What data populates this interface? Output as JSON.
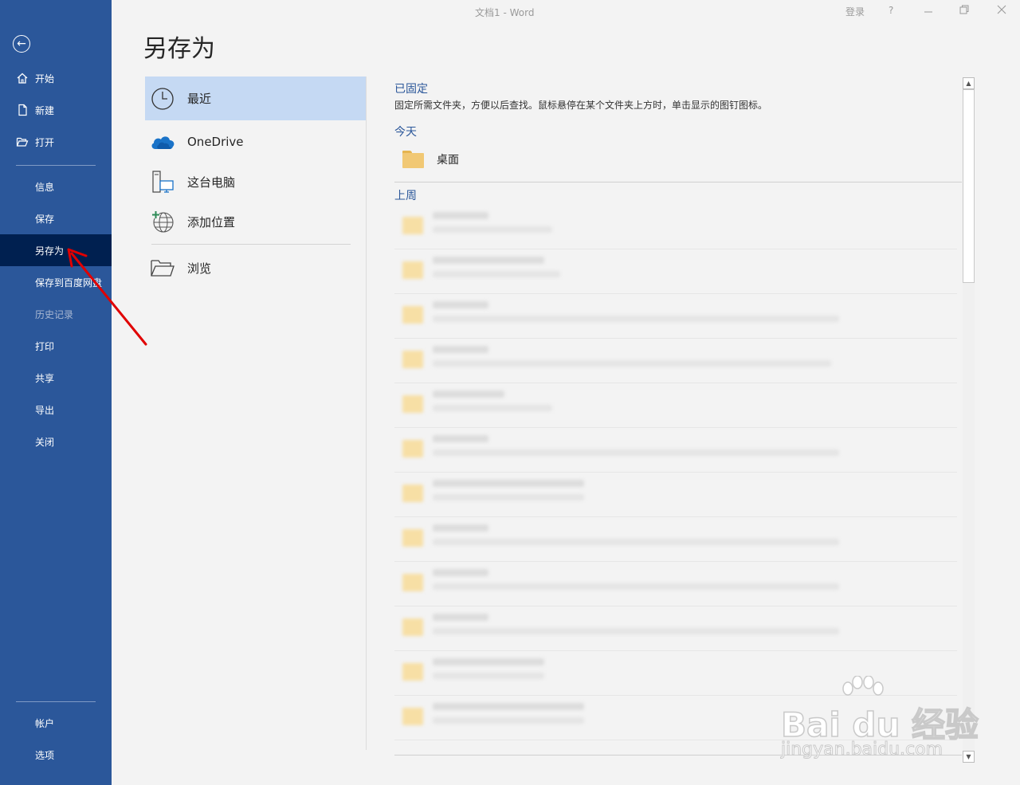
{
  "window": {
    "title": "文档1  -  Word",
    "signin_label": "登录",
    "help_label": "?"
  },
  "sidebar": {
    "top_items": [
      {
        "label": "开始",
        "icon": "home-icon"
      },
      {
        "label": "新建",
        "icon": "new-document-icon"
      },
      {
        "label": "打开",
        "icon": "open-folder-icon"
      }
    ],
    "items": [
      {
        "label": "信息"
      },
      {
        "label": "保存"
      },
      {
        "label": "另存为",
        "active": true
      },
      {
        "label": "保存到百度网盘"
      },
      {
        "label": "历史记录",
        "disabled": true
      },
      {
        "label": "打印"
      },
      {
        "label": "共享"
      },
      {
        "label": "导出"
      },
      {
        "label": "关闭"
      }
    ],
    "bottom_items": [
      {
        "label": "帐户"
      },
      {
        "label": "选项"
      }
    ]
  },
  "page": {
    "title": "另存为"
  },
  "locations": {
    "items": [
      {
        "label": "最近",
        "icon": "clock-icon",
        "active": true
      },
      {
        "label": "OneDrive",
        "icon": "onedrive-cloud-icon"
      },
      {
        "label": "这台电脑",
        "icon": "this-pc-icon"
      },
      {
        "label": "添加位置",
        "icon": "add-place-globe-icon"
      },
      {
        "label": "浏览",
        "icon": "browse-folder-icon"
      }
    ]
  },
  "recent": {
    "pinned_heading": "已固定",
    "pinned_description": "固定所需文件夹，方便以后查找。鼠标悬停在某个文件夹上方时，单击显示的图钉图标。",
    "today_heading": "今天",
    "today_folders": [
      {
        "name": "桌面"
      }
    ],
    "last_week_heading": "上周"
  },
  "watermark": {
    "main": "Bai du 经验",
    "sub": "jingyan.baidu.com"
  },
  "colors": {
    "sidebar_bg": "#2b579a",
    "sidebar_active": "#002050",
    "location_active": "#c5d9f3",
    "heading_blue": "#2b579a",
    "annotation_arrow": "#e00000"
  }
}
